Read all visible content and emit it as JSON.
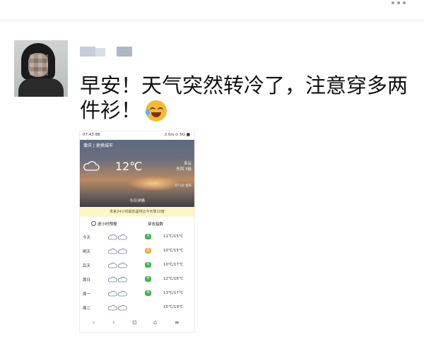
{
  "post": {
    "text": "早安！天气突然转冷了，注意穿多两件衫！",
    "emoji": "face-with-tears-of-joy-icon"
  },
  "phone": {
    "status_time": "07:43 88",
    "status_right": "2.0/s ⊙ 5G ■",
    "location": "肇庆 | 更换城市",
    "temperature": "12℃",
    "condition": "多云",
    "wind": "东风 3级",
    "update": "07:20 发布",
    "today_label": "今日详情",
    "notice": "未来24小时最低温将比今天降10度",
    "tabs": [
      "逐小时预报",
      "穿衣指数"
    ],
    "forecast": [
      {
        "day": "今天",
        "aqi": "优",
        "aqi_level": "good",
        "range": "11℃/15℃"
      },
      {
        "day": "明天",
        "aqi": "良",
        "aqi_level": "mid",
        "range": "10℃/15℃"
      },
      {
        "day": "后天",
        "aqi": "优",
        "aqi_level": "good",
        "range": "10℃/17℃"
      },
      {
        "day": "周日",
        "aqi": "优",
        "aqi_level": "good",
        "range": "12℃/16℃"
      },
      {
        "day": "周一",
        "aqi": "优",
        "aqi_level": "good",
        "range": "13℃/17℃"
      },
      {
        "day": "周二",
        "aqi": "",
        "aqi_level": "none",
        "range": "15℃/19℃"
      }
    ],
    "nav": [
      "‹",
      "›",
      "⊡",
      "⌂",
      "≡"
    ]
  },
  "colors": {
    "aqi_good": "#3fb24f",
    "aqi_mid": "#f1a93b",
    "notice_bg": "#fdf6c9"
  }
}
